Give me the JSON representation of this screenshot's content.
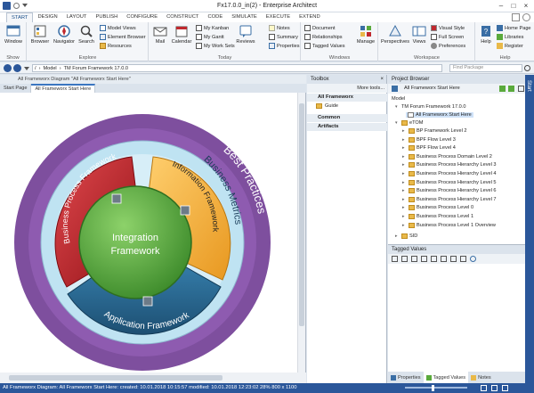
{
  "window": {
    "title": "Fx17.0.0_in(2) - Enterprise Architect"
  },
  "tabs": [
    "START",
    "DESIGN",
    "LAYOUT",
    "PUBLISH",
    "CONFIGURE",
    "CONSTRUCT",
    "CODE",
    "SIMULATE",
    "EXECUTE",
    "EXTEND"
  ],
  "ribbon": {
    "show": {
      "label": "Show",
      "window_btn": "Window"
    },
    "explore": {
      "label": "Explore",
      "browser": "Browser",
      "navigator": "Navigator",
      "search": "Search",
      "model_views": "Model Views",
      "element_browser": "Element Browser",
      "resources": "Resources"
    },
    "today": {
      "label": "Today",
      "mail": "Mail",
      "calendar": "Calendar",
      "kanban": "My Kanban",
      "gantt": "My Gantt",
      "worksets": "My Work Sets",
      "reviews": "Reviews",
      "notes": "Notes",
      "summary": "Summary",
      "properties": "Properties"
    },
    "windows": {
      "label": "Windows",
      "document": "Document",
      "relationships": "Relationships",
      "tagged_values": "Tagged Values",
      "manage": "Manage"
    },
    "workspace": {
      "label": "Workspace",
      "perspectives": "Perspectives",
      "views": "Views",
      "visual_style": "Visual Style",
      "full_screen": "Full Screen",
      "preferences": "Preferences"
    },
    "help": {
      "label": "Help",
      "help_btn": "Help",
      "home_page": "Home Page",
      "libraries": "Libraries",
      "register": "Register"
    }
  },
  "addr": {
    "path": [
      "/",
      "Model",
      "TM Forum Framework 17.0.0"
    ],
    "find_placeholder": "Find Package"
  },
  "diagram": {
    "caption": "All Frameworx Diagram  \"All Frameworx Start Here\"",
    "tabs": [
      "Start Page",
      "All Frameworx Start Here"
    ],
    "labels": {
      "center1": "Integration",
      "center2": "Framework",
      "red": "Business Process Framework",
      "yellow": "Information Framework",
      "blue": "Application Framework",
      "outer1": "Business Metrics",
      "outer2": "Best Practices"
    }
  },
  "toolbox": {
    "title": "Toolbox",
    "more": "More tools...",
    "sections": [
      "All Frameworx",
      "Common",
      "Artifacts"
    ],
    "items": [
      "Guide"
    ]
  },
  "browser": {
    "title": "Project Browser",
    "selected": "All Frameworx Start Here",
    "root": "Model",
    "package": "TM Forum Framework 17.0.0",
    "diagram": "All Frameworx Start Here",
    "etom": "eTOM",
    "children": [
      "BP Framework Level 2",
      "BPF Flow Level 3",
      "BPF Flow Level 4",
      "Business Process Domain Level 2",
      "Business Process Hierarchy Level 3",
      "Business Process Hierarchy Level 4",
      "Business Process Hierarchy Level 5",
      "Business Process Hierarchy Level 6",
      "Business Process Hierarchy Level 7",
      "Business Process Level 0",
      "Business Process Level 1",
      "Business Process Level 1 Overview"
    ],
    "sid": "SID"
  },
  "tagged": {
    "title": "Tagged Values"
  },
  "bottom_tabs": [
    "Properties",
    "Tagged Values",
    "Notes"
  ],
  "statusbar": {
    "text": "All Frameworx Diagram: All Frameworx Start Here:  created: 10.01.2018 10:15:57  modified: 10.01.2018 12:23:02   28%   800 x 1100"
  },
  "right_edge": {
    "label": "Start"
  },
  "colors": {
    "accent": "#2b579a",
    "red": "#c0282e",
    "yellow": "#f6b03a",
    "green": "#5aaa3c",
    "blue": "#2a6f9b",
    "purple": "#7e4f9e",
    "lightblue": "#bfe3f2"
  }
}
